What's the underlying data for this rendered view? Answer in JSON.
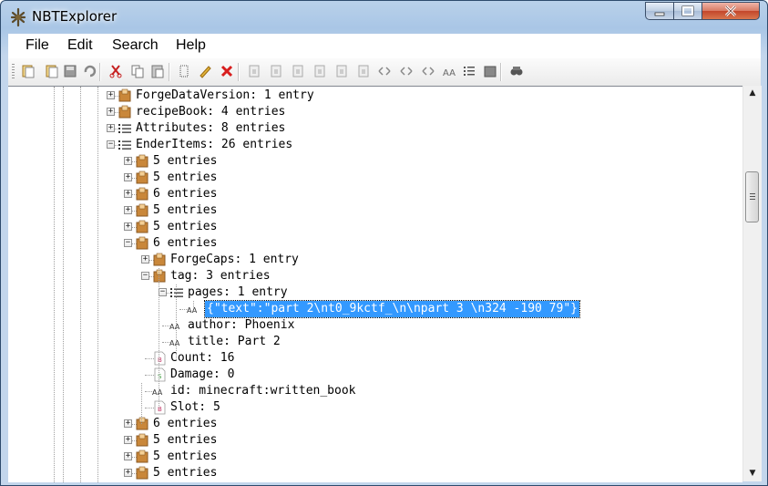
{
  "window": {
    "title": "NBTExplorer"
  },
  "menu": [
    "File",
    "Edit",
    "Search",
    "Help"
  ],
  "toolbar": {
    "icons": [
      "open-file-icon",
      "open-folder-icon",
      "save-icon",
      "refresh-icon",
      "cut-icon",
      "copy-icon",
      "paste-icon",
      "rename-icon",
      "edit-icon",
      "delete-icon",
      "add-byte-icon",
      "add-short-icon",
      "add-int-icon",
      "add-long-icon",
      "add-float-icon",
      "add-double-icon",
      "add-byte-array-icon",
      "add-int-array-icon",
      "add-long-array-icon",
      "add-string-icon",
      "add-list-icon",
      "add-compound-icon",
      "find-icon"
    ]
  },
  "tree": {
    "rows": [
      {
        "label": "ForgeDataVersion: 1 entry",
        "icon": "compound",
        "expander": "+"
      },
      {
        "label": "recipeBook: 4 entries",
        "icon": "compound",
        "expander": "+"
      },
      {
        "label": "Attributes: 8 entries",
        "icon": "list",
        "expander": "+"
      },
      {
        "label": "EnderItems: 26 entries",
        "icon": "list",
        "expander": "-"
      },
      {
        "label": "5 entries",
        "icon": "compound",
        "expander": "+"
      },
      {
        "label": "5 entries",
        "icon": "compound",
        "expander": "+"
      },
      {
        "label": "6 entries",
        "icon": "compound",
        "expander": "+"
      },
      {
        "label": "5 entries",
        "icon": "compound",
        "expander": "+"
      },
      {
        "label": "5 entries",
        "icon": "compound",
        "expander": "+"
      },
      {
        "label": "6 entries",
        "icon": "compound",
        "expander": "-"
      },
      {
        "label": "ForgeCaps: 1 entry",
        "icon": "compound",
        "expander": "+"
      },
      {
        "label": "tag: 3 entries",
        "icon": "compound",
        "expander": "-"
      },
      {
        "label": "pages: 1 entry",
        "icon": "list",
        "expander": "-"
      },
      {
        "label": "{\"text\":\"part 2\\nt0_9kctf_\\n\\npart 3 \\n324 -190 79\"}",
        "icon": "string",
        "expander": ""
      },
      {
        "label": "author: Phoenix",
        "icon": "string",
        "expander": ""
      },
      {
        "label": "title: Part 2",
        "icon": "string",
        "expander": ""
      },
      {
        "label": "Count: 16",
        "icon": "byte",
        "expander": ""
      },
      {
        "label": "Damage: 0",
        "icon": "short",
        "expander": ""
      },
      {
        "label": "id: minecraft:written_book",
        "icon": "string",
        "expander": ""
      },
      {
        "label": "Slot: 5",
        "icon": "byte",
        "expander": ""
      },
      {
        "label": "6 entries",
        "icon": "compound",
        "expander": "+"
      },
      {
        "label": "5 entries",
        "icon": "compound",
        "expander": "+"
      },
      {
        "label": "5 entries",
        "icon": "compound",
        "expander": "+"
      },
      {
        "label": "5 entries",
        "icon": "compound",
        "expander": "+"
      }
    ]
  },
  "glyphs": {
    "string": "AA",
    "byte": "B",
    "short": "S"
  },
  "colors": {
    "selection": "#3399ff"
  }
}
